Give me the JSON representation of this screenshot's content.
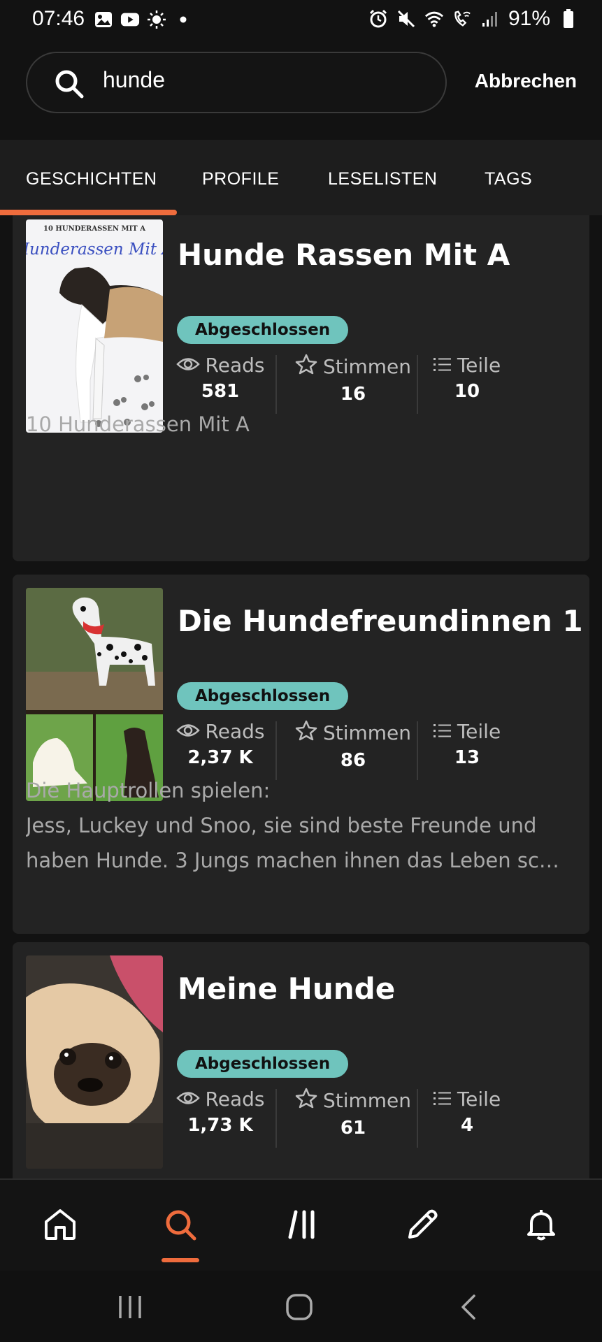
{
  "status_bar": {
    "time": "07:46",
    "battery": "91%",
    "left_icons": [
      "image-icon",
      "youtube-icon",
      "brightness-icon",
      "dot-icon"
    ],
    "right_icons": [
      "alarm-icon",
      "mute-icon",
      "wifi-icon",
      "wifi-call-icon",
      "signal-icon",
      "battery-icon"
    ]
  },
  "search": {
    "value": "hunde",
    "cancel_label": "Abbrechen"
  },
  "tabs": [
    {
      "label": "GESCHICHTEN",
      "active": true
    },
    {
      "label": "PROFILE",
      "active": false
    },
    {
      "label": "LESELISTEN",
      "active": false
    },
    {
      "label": "TAGS",
      "active": false
    }
  ],
  "stories": [
    {
      "title": "Hunde Rassen Mit A",
      "status": "Abgeschlossen",
      "cover_text_top": "10 HUNDERASSEN MIT A",
      "cover_text_script": "Hunderassen Mit A",
      "reads_label": "Reads",
      "reads": "581",
      "votes_label": "Stimmen",
      "votes": "16",
      "parts_label": "Teile",
      "parts": "10",
      "description": [
        "10 Hunderassen Mit A"
      ]
    },
    {
      "title": "Die Hundefreundinnen 1",
      "status": "Abgeschlossen",
      "reads_label": "Reads",
      "reads": "2,37 K",
      "votes_label": "Stimmen",
      "votes": "86",
      "parts_label": "Teile",
      "parts": "13",
      "description": [
        "Die Hauptrollen spielen:",
        "Jess, Luckey und Snoo, sie sind beste Freunde und",
        "haben Hunde. 3 Jungs machen ihnen das Leben sc…"
      ]
    },
    {
      "title": "Meine Hunde",
      "status": "Abgeschlossen",
      "reads_label": "Reads",
      "reads": "1,73 K",
      "votes_label": "Stimmen",
      "votes": "61",
      "parts_label": "Teile",
      "parts": "4",
      "description": []
    }
  ],
  "bottom_nav": [
    {
      "name": "home-icon",
      "active": false
    },
    {
      "name": "search-icon",
      "active": true
    },
    {
      "name": "library-icon",
      "active": false
    },
    {
      "name": "write-icon",
      "active": false
    },
    {
      "name": "bell-icon",
      "active": false
    }
  ],
  "colors": {
    "accent": "#ef6c3d",
    "badge": "#6fc4bd",
    "card": "#232323",
    "background": "#121212"
  }
}
